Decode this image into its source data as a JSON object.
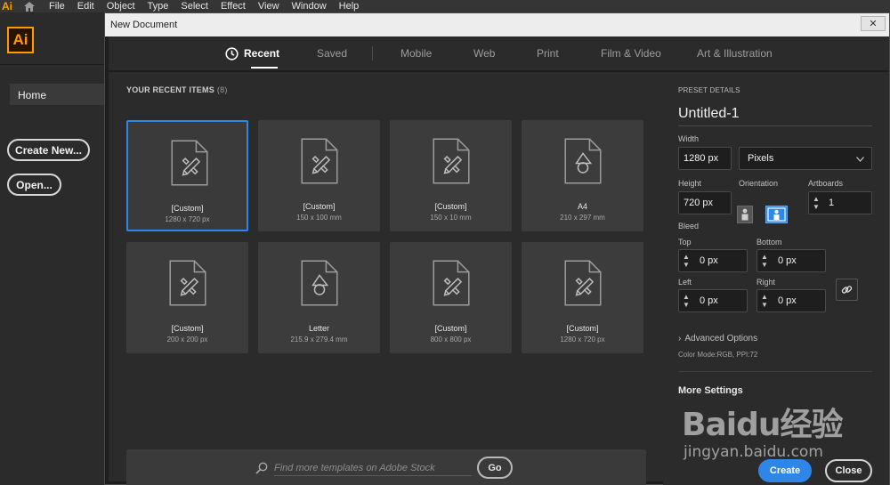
{
  "app": {
    "logo": "Ai",
    "menu": [
      "File",
      "Edit",
      "Object",
      "Type",
      "Select",
      "Effect",
      "View",
      "Window",
      "Help"
    ]
  },
  "sidebar": {
    "home_label": "Home",
    "create_new_label": "Create New...",
    "open_label": "Open..."
  },
  "dialog": {
    "title": "New Document",
    "close_glyph": "✕",
    "tabs": [
      "Recent",
      "Saved",
      "Mobile",
      "Web",
      "Print",
      "Film & Video",
      "Art & Illustration"
    ],
    "active_tab": "Recent"
  },
  "recent": {
    "title": "YOUR RECENT ITEMS",
    "count": "(8)",
    "items": [
      {
        "name": "[Custom]",
        "size": "1280 x 720 px",
        "icon": "pencil-ruler-icon"
      },
      {
        "name": "[Custom]",
        "size": "150 x 100 mm",
        "icon": "pencil-ruler-icon"
      },
      {
        "name": "[Custom]",
        "size": "150 x 10 mm",
        "icon": "pencil-ruler-icon"
      },
      {
        "name": "A4",
        "size": "210 x 297 mm",
        "icon": "shapes-icon"
      },
      {
        "name": "[Custom]",
        "size": "200 x 200 px",
        "icon": "pencil-ruler-icon"
      },
      {
        "name": "Letter",
        "size": "215.9 x 279.4 mm",
        "icon": "shapes-icon"
      },
      {
        "name": "[Custom]",
        "size": "800 x 800 px",
        "icon": "pencil-ruler-icon"
      },
      {
        "name": "[Custom]",
        "size": "1280 x 720 px",
        "icon": "pencil-ruler-icon"
      }
    ],
    "selected_index": 0
  },
  "search": {
    "placeholder": "Find more templates on Adobe Stock",
    "go_label": "Go"
  },
  "details": {
    "header": "PRESET DETAILS",
    "doc_name": "Untitled-1",
    "width_label": "Width",
    "width_value": "1280 px",
    "units_value": "Pixels",
    "height_label": "Height",
    "height_value": "720 px",
    "orientation_label": "Orientation",
    "artboards_label": "Artboards",
    "artboards_value": "1",
    "bleed_label": "Bleed",
    "top_label": "Top",
    "top_value": "0 px",
    "bottom_label": "Bottom",
    "bottom_value": "0 px",
    "left_label": "Left",
    "left_value": "0 px",
    "right_label": "Right",
    "right_value": "0 px",
    "advanced_options": "Advanced Options",
    "color_mode": "Color Mode:RGB, PPI:72",
    "more_settings": "More Settings",
    "create_label": "Create",
    "close_label": "Close"
  },
  "watermark": {
    "main": "Baidu经验",
    "sub": "jingyan.baidu.com"
  },
  "colors": {
    "accent": "#2e86e8",
    "brand": "#ff9a00",
    "dialog_bg": "#2b2b2b"
  }
}
